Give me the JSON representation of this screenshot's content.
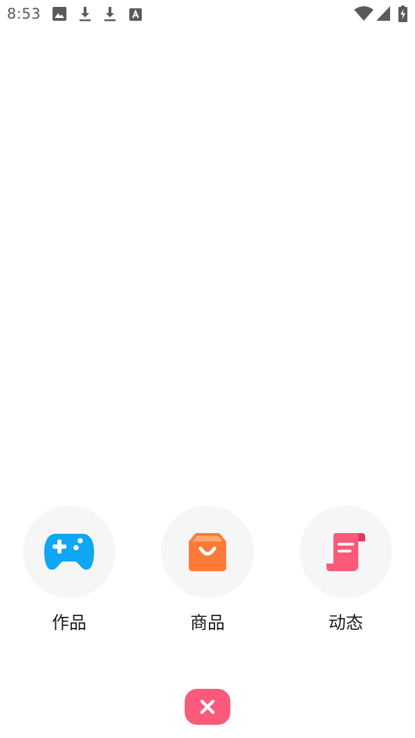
{
  "status_bar": {
    "time": "8:53",
    "icons": [
      "image-icon",
      "download-icon",
      "download-icon",
      "font-icon",
      "wifi-icon",
      "signal-icon",
      "battery-charging-icon"
    ]
  },
  "actions": [
    {
      "label": "作品",
      "icon": "gamepad-icon",
      "color": "#0fa6f4"
    },
    {
      "label": "商品",
      "icon": "shopping-bag-icon",
      "color": "#ff7a36"
    },
    {
      "label": "动态",
      "icon": "scroll-icon",
      "color": "#fb5a7a"
    }
  ],
  "close": {
    "icon": "close-icon",
    "color": "#fb5a7a"
  }
}
